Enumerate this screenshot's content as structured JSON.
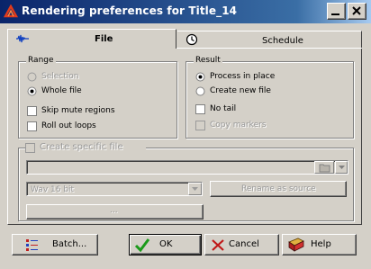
{
  "window": {
    "title": "Rendering preferences for Title_14",
    "icon": "red-triangle-app-icon"
  },
  "tabs": [
    {
      "label": "File",
      "icon": "waveform-icon",
      "selected": true
    },
    {
      "label": "Schedule",
      "icon": "clock-icon",
      "selected": false
    }
  ],
  "range": {
    "title": "Range",
    "options": [
      {
        "label": "Selection",
        "type": "radio",
        "checked": false,
        "enabled": false
      },
      {
        "label": "Whole file",
        "type": "radio",
        "checked": true,
        "enabled": true
      },
      {
        "label": "Skip mute regions",
        "type": "checkbox",
        "checked": false,
        "enabled": true
      },
      {
        "label": "Roll out loops",
        "type": "checkbox",
        "checked": false,
        "enabled": true
      }
    ]
  },
  "result": {
    "title": "Result",
    "options": [
      {
        "label": "Process in place",
        "type": "radio",
        "checked": true,
        "enabled": true
      },
      {
        "label": "Create new file",
        "type": "radio",
        "checked": false,
        "enabled": true
      },
      {
        "label": "No tail",
        "type": "checkbox",
        "checked": false,
        "enabled": true
      },
      {
        "label": "Copy markers",
        "type": "checkbox",
        "checked": false,
        "enabled": false
      }
    ]
  },
  "specific_file": {
    "label": "Create specific file",
    "path_value": "",
    "format_value": "Wav 16 bit",
    "rename_label": "Rename as source",
    "options_label": "..."
  },
  "buttons": {
    "batch": "Batch...",
    "ok": "OK",
    "cancel": "Cancel",
    "help": "Help"
  },
  "colors": {
    "titlebar_start": "#0a246a",
    "titlebar_end": "#a6caf0",
    "face": "#d4d0c8",
    "ok_check": "#1a9a1a",
    "cancel_x": "#c01818"
  }
}
